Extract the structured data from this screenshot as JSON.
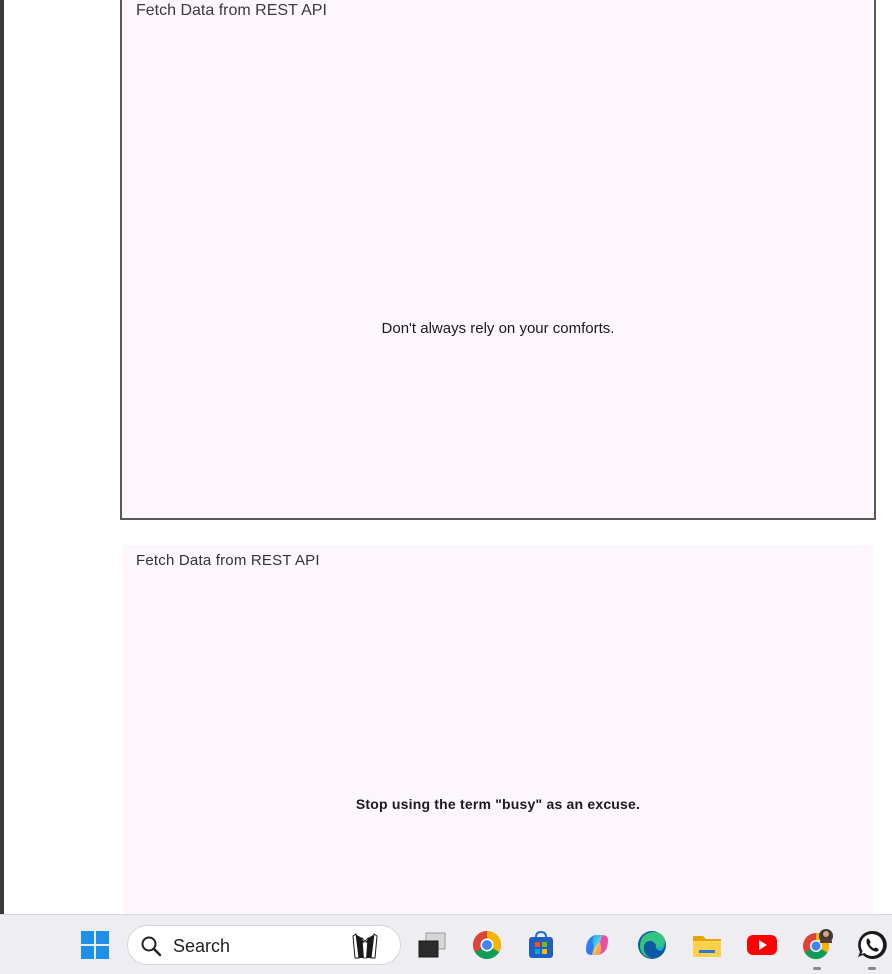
{
  "cards": [
    {
      "title": "Fetch Data from REST API",
      "quote": "Don't always rely on your comforts."
    },
    {
      "title": "Fetch Data from REST API",
      "quote": "Stop using the term \"busy\" as an excuse."
    }
  ],
  "taskbar": {
    "search_placeholder": "Search",
    "icons": [
      "windows-start-icon",
      "search-icon",
      "butler-highlight-icon",
      "task-view-icon",
      "chrome-icon",
      "microsoft-store-icon",
      "copilot-icon",
      "edge-icon",
      "file-explorer-icon",
      "youtube-icon",
      "chrome-profile-icon",
      "whatsapp-icon"
    ]
  },
  "colors": {
    "card_bg": "#fdf7fd",
    "taskbar_bg": "#eeeef2",
    "windows_blue": "#1e90e8",
    "youtube_red": "#ff0000",
    "whatsapp_green": "#25d366"
  }
}
